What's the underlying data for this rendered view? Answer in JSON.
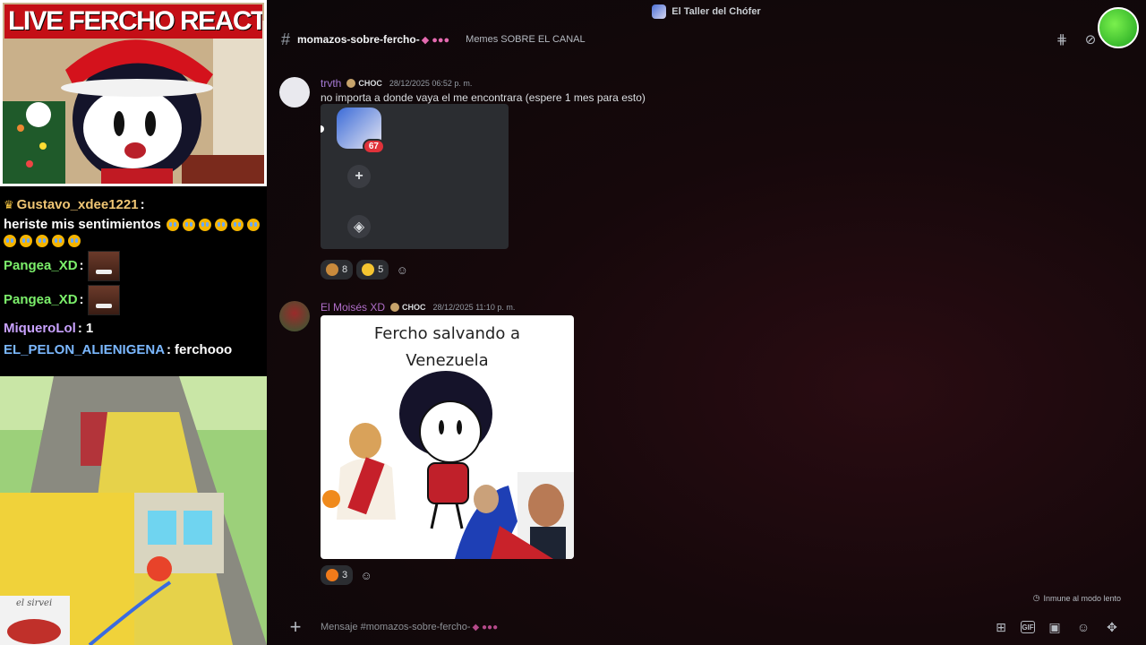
{
  "stream": {
    "cam_title": "LIVE FERCHO REACTION",
    "chat": [
      {
        "user": "Gustavo_xdee1221",
        "text": "heriste mis sentimientos",
        "emote_count": 11
      },
      {
        "user": "Pangea_XD",
        "text": ""
      },
      {
        "user": "Pangea_XD",
        "text": ""
      },
      {
        "user": "MiqueroLol",
        "text": "1"
      },
      {
        "user": "EL_PELON_ALIENIGENA",
        "text": "ferchooo"
      }
    ],
    "game_watermark": "el sirvei"
  },
  "discord": {
    "server_name": "El Taller del Chófer",
    "channel_name": "momazos-sobre-fercho-",
    "channel_topic": "Memes SOBRE EL CANAL",
    "messages": [
      {
        "author": "trvth",
        "tag": "CHOC",
        "timestamp": "28/12/2025 06:52 p. m.",
        "text": "no importa a donde vaya el me encontrara (espere 1 mes para esto)",
        "embed_badge": "67",
        "reactions": [
          {
            "icon": "praying-emoji",
            "count": "8"
          },
          {
            "icon": "pleading-emoji",
            "count": "5"
          }
        ]
      },
      {
        "author": "El Moisés XD",
        "tag": "CHOC",
        "timestamp": "28/12/2025 11:10 p. m.",
        "image_caption_line1": "Fercho salvando a",
        "image_caption_line2": "Venezuela",
        "reactions": [
          {
            "icon": "fire-emoji",
            "count": "3"
          }
        ]
      }
    ],
    "slowmode_text": "Inmune al modo lento",
    "composer_placeholder": "Mensaje #momazos-sobre-fercho-"
  }
}
